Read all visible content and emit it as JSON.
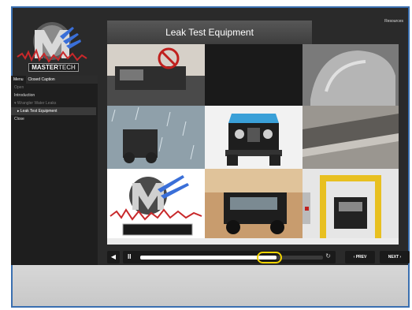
{
  "top_bar": {
    "resources_label": "Resources"
  },
  "logo": {
    "text_master": "MASTER",
    "text_tech": "TECH"
  },
  "sidebar": {
    "tabs": [
      {
        "label": "Menu",
        "active": true
      },
      {
        "label": "Closed Caption",
        "active": false
      }
    ],
    "items": [
      {
        "label": "Open",
        "state": "dim"
      },
      {
        "label": "Introduction",
        "state": "normal"
      },
      {
        "label": "▾  Wrangler Water Leaks",
        "state": "dim2"
      },
      {
        "label": "▸  Leak Test Equipment",
        "state": "selected"
      },
      {
        "label": "Close",
        "state": "normal"
      }
    ]
  },
  "slide": {
    "title": "Leak Test Equipment"
  },
  "player": {
    "volume_icon": "speaker-icon",
    "pause_icon": "pause-icon",
    "replay_icon": "replay-icon",
    "progress": 0.7,
    "prev_label": "‹ PREV",
    "next_label": "NEXT ›"
  },
  "colors": {
    "frame_border": "#3a6fb0",
    "highlight_ring": "#f2d400",
    "panel_dark": "#2a2a2a"
  }
}
